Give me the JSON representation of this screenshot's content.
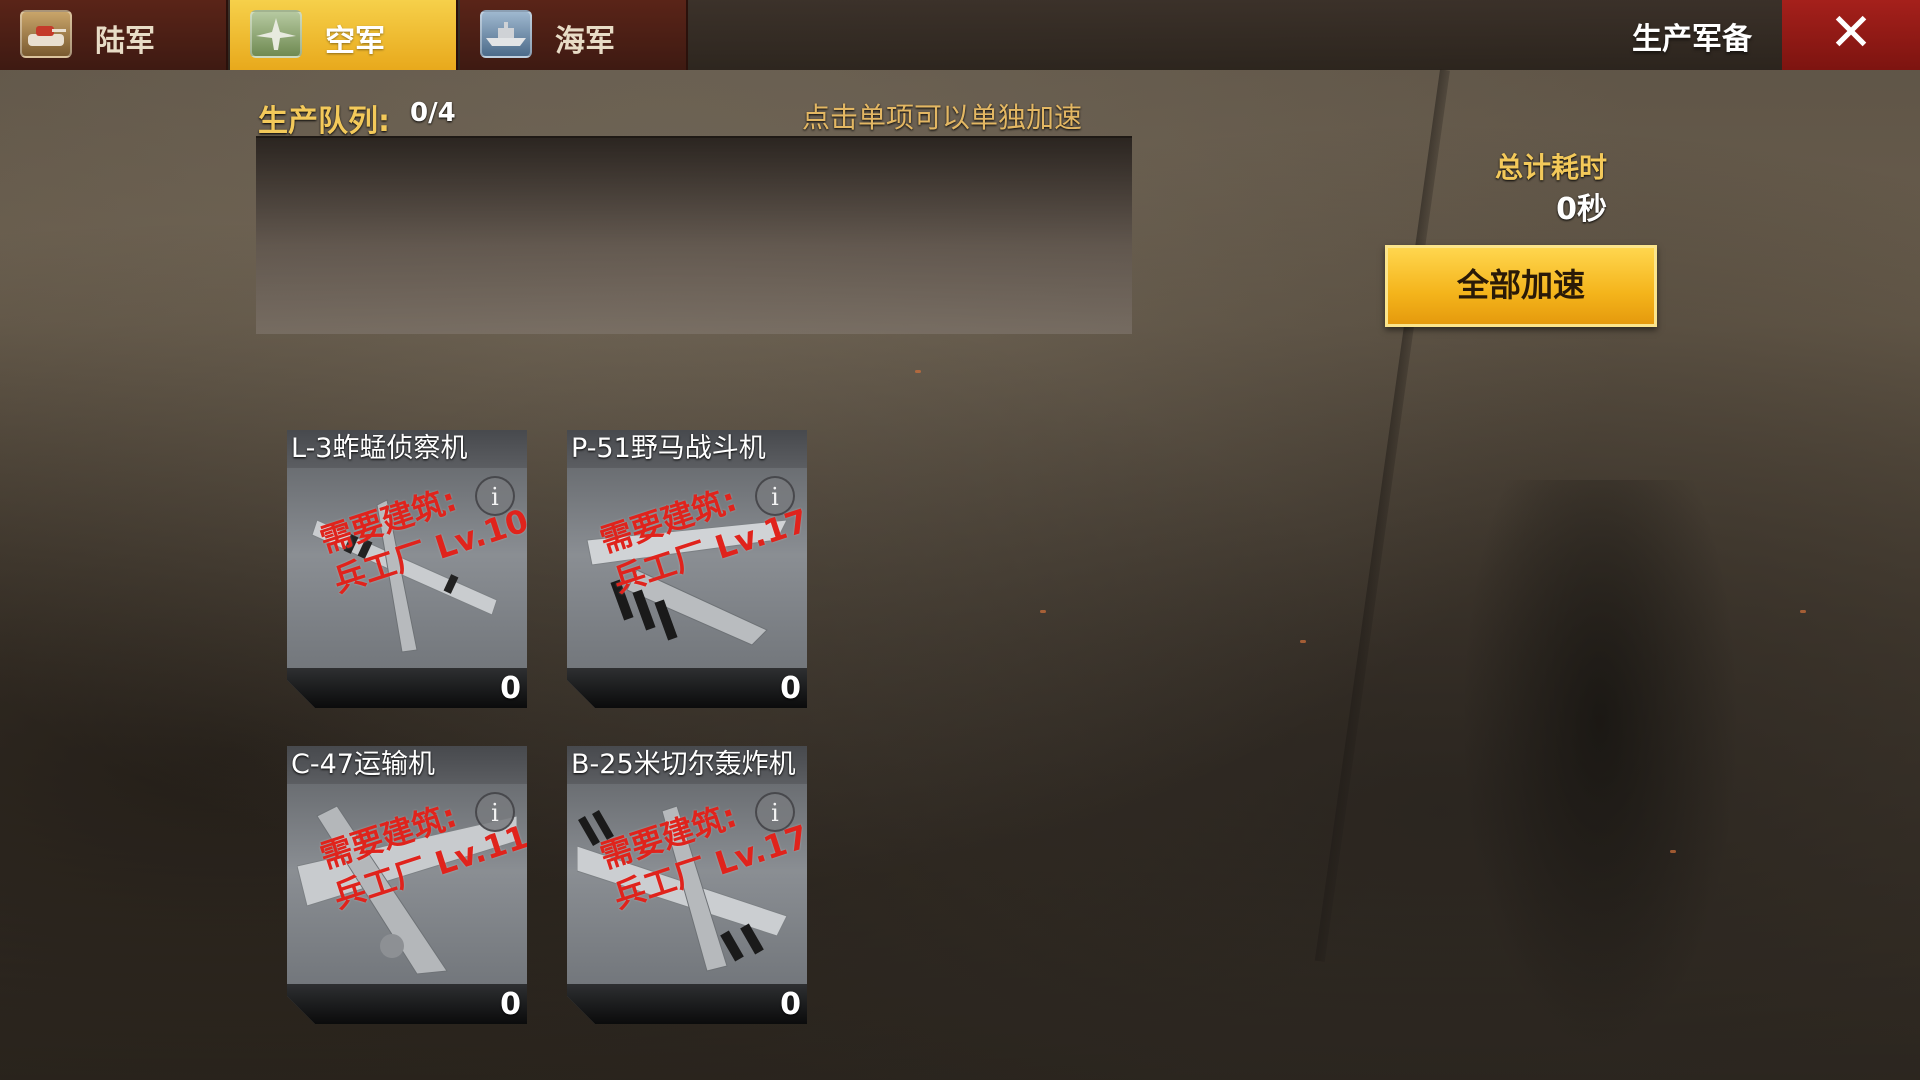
{
  "tabs": [
    {
      "label": "陆军",
      "icon": "tank-icon",
      "active": false
    },
    {
      "label": "空军",
      "icon": "plane-icon",
      "active": true
    },
    {
      "label": "海军",
      "icon": "ship-icon",
      "active": false
    }
  ],
  "header": {
    "title": "生产军备",
    "close_icon": "close-icon"
  },
  "queue": {
    "label": "生产队列:",
    "count": "0/4",
    "hint": "点击单项可以单独加速"
  },
  "total": {
    "label": "总计耗时",
    "value": "0秒",
    "speedup_label": "全部加速"
  },
  "units": [
    {
      "name": "L-3蚱蜢侦察机",
      "requirement_line1": "需要建筑:",
      "requirement_line2": "兵工厂 Lv.10",
      "count": "0",
      "info": "i"
    },
    {
      "name": "P-51野马战斗机",
      "requirement_line1": "需要建筑:",
      "requirement_line2": "兵工厂 Lv.17",
      "count": "0",
      "info": "i"
    },
    {
      "name": "C-47运输机",
      "requirement_line1": "需要建筑:",
      "requirement_line2": "兵工厂 Lv.11",
      "count": "0",
      "info": "i"
    },
    {
      "name": "B-25米切尔轰炸机",
      "requirement_line1": "需要建筑:",
      "requirement_line2": "兵工厂 Lv.17",
      "count": "0",
      "info": "i"
    }
  ],
  "colors": {
    "accent_gold": "#f4b41b",
    "tab_inactive": "#5a2418",
    "close_red": "#a5201b",
    "requirement_red": "#e0231c"
  }
}
